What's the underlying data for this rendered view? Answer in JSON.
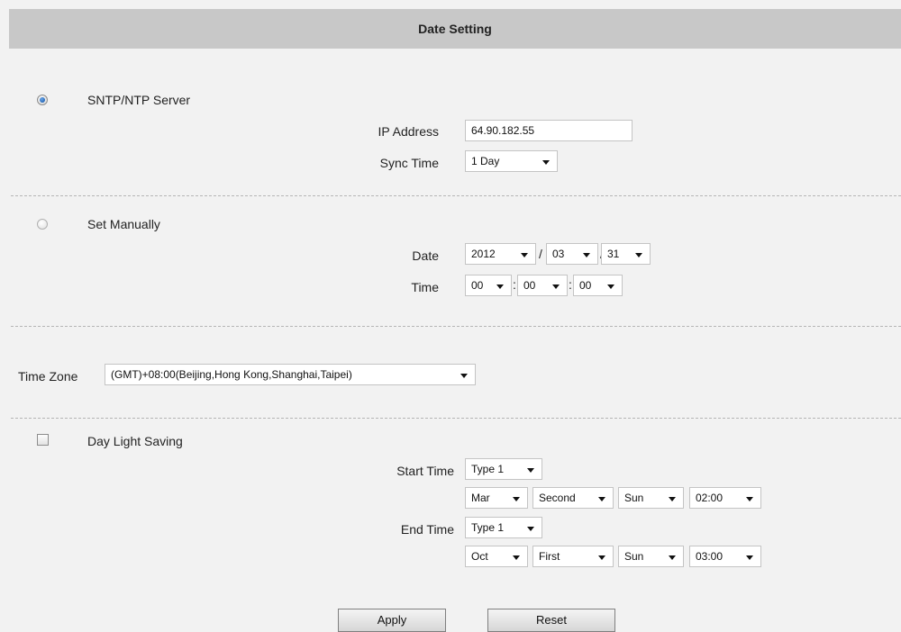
{
  "header": {
    "title": "Date Setting"
  },
  "sntp": {
    "label": "SNTP/NTP Server",
    "selected": true,
    "ip_label": "IP Address",
    "ip_value": "64.90.182.55",
    "sync_label": "Sync Time",
    "sync_value": "1 Day"
  },
  "manual": {
    "label": "Set Manually",
    "selected": false,
    "date_label": "Date",
    "year": "2012",
    "month": "03",
    "day": "31",
    "date_sep": "/",
    "time_label": "Time",
    "hour": "00",
    "minute": "00",
    "second": "00",
    "time_sep": ":"
  },
  "timezone": {
    "label": "Time Zone",
    "value": "(GMT)+08:00(Beijing,Hong Kong,Shanghai,Taipei)"
  },
  "dst": {
    "label": "Day Light Saving",
    "checked": false,
    "start_label": "Start Time",
    "start_type": "Type 1",
    "start_month": "Mar",
    "start_week": "Second",
    "start_day": "Sun",
    "start_time": "02:00",
    "end_label": "End Time",
    "end_type": "Type 1",
    "end_month": "Oct",
    "end_week": "First",
    "end_day": "Sun",
    "end_time": "03:00"
  },
  "buttons": {
    "apply": "Apply",
    "reset": "Reset"
  },
  "icons": {
    "dropdown": "chevron-down-icon"
  }
}
